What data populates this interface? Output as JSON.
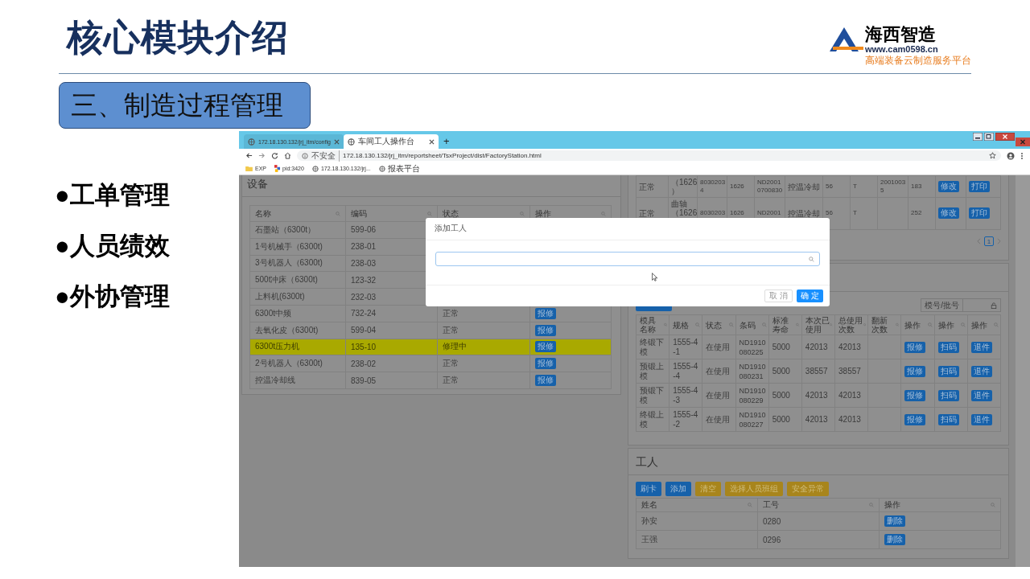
{
  "slide": {
    "title": "核心模块介绍",
    "logo": {
      "name": "海西智造",
      "url": "www.cam0598.cn",
      "tagline": "高端装备云制造服务平台"
    },
    "section": "三、制造过程管理",
    "bullets": [
      {
        "marker": "●",
        "text": "工单管理"
      },
      {
        "marker": "●",
        "text": "人员绩效"
      },
      {
        "marker": "●",
        "text": "外协管理"
      }
    ]
  },
  "browser": {
    "tabs": [
      {
        "label": "172.18.130.132/jrj_itm/config",
        "selected": false
      },
      {
        "label": "车间工人操作台",
        "selected": true
      }
    ],
    "new_tab": "+",
    "security": "不安全",
    "url": "172.18.130.132/jrj_itm/reportsheet/TsxProject/dist/FactoryStation.html",
    "bookmarks": [
      {
        "kind": "folder",
        "label": "EXP"
      },
      {
        "kind": "app",
        "label": "pid:3420"
      },
      {
        "kind": "page",
        "label": "172.18.130.132/jrj..."
      },
      {
        "kind": "page",
        "label": "报表平台"
      }
    ]
  },
  "equipment": {
    "title": "设备",
    "columns": [
      "名称",
      "编码",
      "状态",
      "操作"
    ],
    "rows": [
      {
        "name": "石墨站（6300t）",
        "code": "599-06",
        "highlighted": false
      },
      {
        "name": "1号机械手（6300t)",
        "code": "238-01",
        "highlighted": false
      },
      {
        "name": "3号机器人（6300t)",
        "code": "238-03",
        "highlighted": false
      },
      {
        "name": "500t冲床（6300t)",
        "code": "123-32",
        "highlighted": false
      },
      {
        "name": "上料机(6300t)",
        "code": "232-03",
        "highlighted": false
      },
      {
        "name": "6300t中频",
        "code": "732-24",
        "status": "正常",
        "action": "报修",
        "highlighted": false
      },
      {
        "name": "去氧化皮（6300t)",
        "code": "599-04",
        "status": "正常",
        "action": "报修",
        "highlighted": false
      },
      {
        "name": "6300t压力机",
        "code": "135-10",
        "status": "修理中",
        "action": "报修",
        "highlighted": true
      },
      {
        "name": "2号机器人（6300t)",
        "code": "238-02",
        "status": "正常",
        "action": "报修",
        "highlighted": false
      },
      {
        "name": "控温冷却线",
        "code": "839-05",
        "status": "正常",
        "action": "报修",
        "highlighted": false
      }
    ]
  },
  "parts_table": {
    "rows": [
      {
        "cells": [
          "正常",
          "（1626 ）",
          "8030203 4",
          "1626",
          "ND2001 0700830",
          "控温冷却",
          "56",
          "T",
          "2001003 5",
          "183"
        ],
        "actions": [
          "修改",
          "打印"
        ]
      },
      {
        "cells": [
          "正常",
          "曲轴（1626",
          "8030203",
          "1626",
          "ND2001",
          "控温冷却",
          "56",
          "T",
          "",
          "252"
        ],
        "actions": [
          "修改",
          "打印"
        ]
      }
    ],
    "pagination": {
      "pages": [
        {
          "label": "1",
          "selected": true
        }
      ]
    }
  },
  "molds": {
    "filter_label": "模号/批号",
    "columns": [
      "模具名称",
      "规格",
      "状态",
      "条码",
      "标准寿命",
      "本次已使用",
      "总使用次数",
      "翻新次数",
      "操作",
      "操作",
      "操作"
    ],
    "rows": [
      {
        "cells": [
          "终锻下模",
          "1555-4-1",
          "在使用",
          "ND1910080225",
          "5000",
          "42013",
          "42013",
          ""
        ],
        "actions": [
          "报修",
          "扫码",
          "退件"
        ]
      },
      {
        "cells": [
          "预锻上模",
          "1555-4-4",
          "在使用",
          "ND1910080231",
          "5000",
          "38557",
          "38557",
          ""
        ],
        "actions": [
          "报修",
          "扫码",
          "退件"
        ]
      },
      {
        "cells": [
          "预锻下模",
          "1555-4-3",
          "在使用",
          "ND1910080229",
          "5000",
          "42013",
          "42013",
          ""
        ],
        "actions": [
          "报修",
          "扫码",
          "退件"
        ]
      },
      {
        "cells": [
          "终锻上模",
          "1555-4-2",
          "在使用",
          "ND1910080227",
          "5000",
          "42013",
          "42013",
          ""
        ],
        "actions": [
          "报修",
          "扫码",
          "退件"
        ]
      }
    ]
  },
  "workers": {
    "title": "工人",
    "buttons": [
      {
        "label": "刷卡",
        "kind": "primary"
      },
      {
        "label": "添加",
        "kind": "primary"
      },
      {
        "label": "清空",
        "kind": "warning"
      },
      {
        "label": "选择人员班组",
        "kind": "warning"
      },
      {
        "label": "安全异常",
        "kind": "warning"
      }
    ],
    "columns": [
      "姓名",
      "工号",
      "操作"
    ],
    "rows": [
      {
        "name": "孙安",
        "id": "0280",
        "action": "删除"
      },
      {
        "name": "王强",
        "id": "0296",
        "action": "删除"
      }
    ]
  },
  "dialog": {
    "title": "添加工人",
    "buttons": [
      {
        "label": "取 消",
        "kind": "default"
      },
      {
        "label": "确 定",
        "kind": "primary"
      }
    ]
  }
}
